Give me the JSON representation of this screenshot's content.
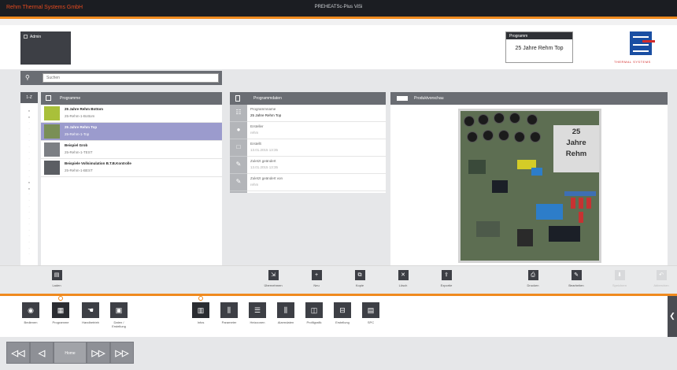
{
  "app": {
    "brand": "Rehm Thermal Systems GmbH",
    "window_title": "PREHEATSc-Plus ViSi"
  },
  "login": {
    "label": "Admin"
  },
  "current_program": {
    "header": "Programm",
    "value": "25 Jahre Rehm Top"
  },
  "logo": {
    "text": "THERMAL SYSTEMS"
  },
  "search": {
    "placeholder": "Suchen",
    "value": ""
  },
  "program_list": {
    "alpha_header": "1-Z",
    "header": "Programme",
    "items": [
      {
        "title": "25 Jahre Rehm Bottom",
        "subtitle": "25-Rehm-1-Bottom"
      },
      {
        "title": "25 Jahre Rehm Top",
        "subtitle": "25-Rehm-1-Top",
        "selected": true
      },
      {
        "title": "Beispiel Grob",
        "subtitle": "25-Rehm-1-TEST"
      },
      {
        "title": "Beispiele Vollsimulation B.T.B.Kontrolle",
        "subtitle": "25-Rehm-1-BEST"
      },
      {
        "title": "",
        "subtitle": ""
      }
    ]
  },
  "details": {
    "header": "Programmdaten",
    "fields": [
      {
        "label": "Programmname",
        "value": "25 Jahre Rehm Top"
      },
      {
        "label": "Ersteller",
        "value": "rehm",
        "muted": true
      },
      {
        "label": "Erstellt",
        "value": "13.01.2015 13:35",
        "muted": true
      },
      {
        "label": "Zuletzt geändert",
        "value": "13.01.2015 13:35",
        "muted": true
      },
      {
        "label": "Zuletzt geändert von",
        "value": "rehm",
        "muted": true
      }
    ]
  },
  "preview": {
    "header": "Produktvorschau",
    "board_label": [
      "25",
      "Jahre",
      "Rehm"
    ]
  },
  "toolbar": [
    {
      "id": "laden",
      "label": "Laden",
      "icon": "▤"
    },
    {
      "id": "uebernehmen",
      "label": "Übernehmen",
      "icon": "⇲"
    },
    {
      "id": "neu",
      "label": "Neu",
      "icon": "+"
    },
    {
      "id": "kopieren",
      "label": "Kopie",
      "icon": "⧉"
    },
    {
      "id": "loeschen",
      "label": "Lösch",
      "icon": "✕"
    },
    {
      "id": "exportieren",
      "label": "Exportie",
      "icon": "⇪"
    },
    {
      "id": "drucken",
      "label": "Drucken",
      "icon": "⎙"
    },
    {
      "id": "bearbeiten",
      "label": "Bearbeiten",
      "icon": "✎"
    },
    {
      "id": "speichern",
      "label": "Speichern",
      "icon": "⬇",
      "disabled": true
    },
    {
      "id": "abbrechen",
      "label": "Abbrechen",
      "icon": "↶",
      "disabled": true
    }
  ],
  "launcher": [
    {
      "id": "bedienen",
      "label": "Bedienen",
      "icon": "◉"
    },
    {
      "id": "programme",
      "label": "Programme",
      "icon": "▦",
      "selected": true
    },
    {
      "id": "handbetrieb",
      "label": "Handbetrieb",
      "icon": "☚"
    },
    {
      "id": "daten",
      "label": "Daten / Erstellung",
      "icon": "▣"
    },
    {
      "id": "infos",
      "label": "Infos",
      "icon": "▥",
      "selected": true
    },
    {
      "id": "parameter",
      "label": "Parameter",
      "icon": "⫼"
    },
    {
      "id": "heizzonen",
      "label": "Heizzonen",
      "icon": "☰"
    },
    {
      "id": "alarmdaten",
      "label": "Alarmdaten",
      "icon": "⫼"
    },
    {
      "id": "profilgrafik",
      "label": "Profilgrafik",
      "icon": "◫"
    },
    {
      "id": "erstellung",
      "label": "Erstellung",
      "icon": "⊟"
    },
    {
      "id": "spc",
      "label": "SPC",
      "icon": "▤"
    }
  ],
  "navbar": {
    "first": "◁◁",
    "prev": "◁",
    "home": "Home",
    "next": "▷▷",
    "last": "▷▷"
  },
  "colors": {
    "accent": "#f08a1e",
    "selection": "#9b9bcd",
    "brand_red": "#e44a1f"
  }
}
